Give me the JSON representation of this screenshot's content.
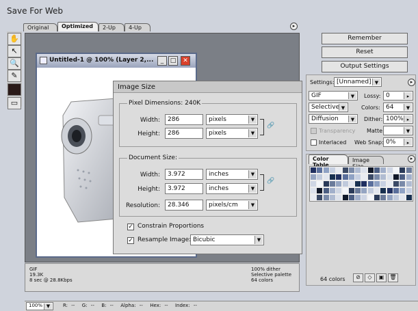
{
  "window": {
    "title": "Save For Web"
  },
  "tabs": [
    "Original",
    "Optimized",
    "2-Up",
    "4-Up"
  ],
  "document": {
    "title": "Untitled-1 @ 100% (Layer 2,..."
  },
  "dialog": {
    "title": "Image Size",
    "pixel_dimensions_label": "Pixel Dimensions:",
    "pixel_dimensions_value": "240K",
    "width_label": "Width:",
    "width_value": "286",
    "height_label": "Height:",
    "height_value": "286",
    "pixel_unit": "pixels",
    "document_size_label": "Document Size:",
    "doc_width_label": "Width:",
    "doc_width_value": "3.972",
    "doc_height_label": "Height:",
    "doc_height_value": "3.972",
    "inch_unit": "inches",
    "resolution_label": "Resolution:",
    "resolution_value": "28.346",
    "resolution_unit": "pixels/cm",
    "constrain_label": "Constrain Proportions",
    "resample_label": "Resample Image:",
    "resample_value": "Bicubic"
  },
  "buttons": {
    "remember": "Remember",
    "reset": "Reset",
    "output_settings": "Output Settings"
  },
  "settings": {
    "settings_label": "Settings:",
    "settings_value": "[Unnamed]",
    "format": "GIF",
    "lossy_label": "Lossy:",
    "lossy_value": "0",
    "palette": "Selective",
    "colors_label": "Colors:",
    "colors_value": "64",
    "dither_algo": "Diffusion",
    "dither_label": "Dither:",
    "dither_value": "100%",
    "transparency_label": "Transparency",
    "matte_label": "Matte:",
    "interlaced_label": "Interlaced",
    "websnap_label": "Web Snap:",
    "websnap_value": "0%"
  },
  "color_table": {
    "tab_active": "Color Table",
    "tab_inactive": "Image Size",
    "count_label": "64 colors"
  },
  "info": {
    "format": "GIF",
    "size": "19.3K",
    "time": "8 sec @ 28.8Kbps",
    "dither": "100% dither",
    "palette": "Selective palette",
    "colors": "64 colors"
  },
  "status": {
    "zoom": "100%",
    "r": "R:",
    "r_val": "--",
    "g": "G:",
    "g_val": "--",
    "b": "B:",
    "b_val": "--",
    "alpha": "Alpha:",
    "alpha_val": "--",
    "hex": "Hex:",
    "hex_val": "--",
    "index": "Index:",
    "index_val": "--"
  },
  "colors": {
    "accent_close": "#d9412b",
    "swatch_palette": [
      "#203060",
      "#5a6f9c",
      "#8fa2c4",
      "#c7d0e2",
      "#e9ecf2",
      "#3b4a66",
      "#7a8aa8",
      "#b0bcd2",
      "#dde2ec",
      "#101828",
      "#4c5e82",
      "#a2b0cb",
      "#cfd6e4",
      "#f4f6f9",
      "#2a3a58",
      "#6b7b9a",
      "#95a5c2",
      "#c0cadc",
      "#e2e6ee",
      "#183050"
    ]
  }
}
